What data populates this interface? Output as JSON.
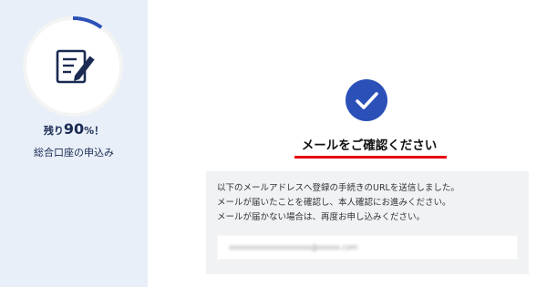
{
  "sidebar": {
    "progress_percent": 90,
    "remaining_prefix": "残り",
    "remaining_value": "90",
    "remaining_suffix": "%！",
    "caption": "総合口座の申込み",
    "icon": "document-edit-icon"
  },
  "main": {
    "success_icon": "checkmark-icon",
    "title": "メールをご確認ください",
    "message_lines": [
      "以下のメールアドレスへ登録の手続きのURLを送信しました。",
      "メールが届いたことを確認し、本人確認にお進みください。",
      "メールが届かない場合は、再度お申し込みください。"
    ],
    "email_value": "xxxxxxxxxxxxxxxxxxx@xxxxx.com"
  },
  "colors": {
    "sidebar_bg": "#e8eff8",
    "accent_blue": "#2b50b8",
    "navy_text": "#1a2a52",
    "title_underline": "#e60012",
    "info_box_bg": "#f1f2f4"
  }
}
